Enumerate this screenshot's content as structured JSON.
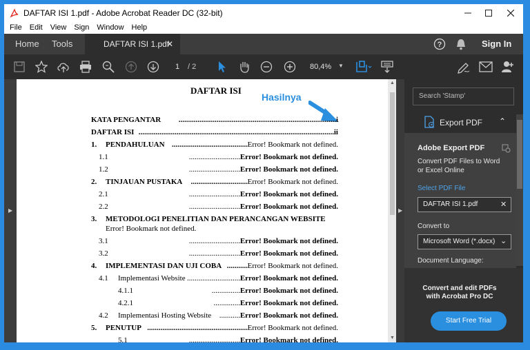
{
  "window": {
    "title": "DAFTAR ISI 1.pdf - Adobe Acrobat Reader DC (32-bit)"
  },
  "menu": [
    "File",
    "Edit",
    "View",
    "Sign",
    "Window",
    "Help"
  ],
  "tabs": {
    "home": "Home",
    "tools": "Tools",
    "document": "DAFTAR ISI 1.pdf",
    "sign_in": "Sign In"
  },
  "toolbar": {
    "page_current": "1",
    "page_total": "/ 2",
    "zoom": "80,4%"
  },
  "annotation": {
    "label": "Hasilnya",
    "color": "#2b8fe0"
  },
  "document": {
    "title": "DAFTAR ISI",
    "lines": [
      {
        "id": "l1",
        "num": "",
        "label": "KATA PENGANTAR",
        "dots": "...................................................................................",
        "tail": "i",
        "bold": true
      },
      {
        "id": "l2",
        "num": "",
        "label": "DAFTAR ISI",
        "dots": ".......................................................................................................",
        "tail": "ii",
        "bold": true
      },
      {
        "id": "l3",
        "num": "1.",
        "label": "PENDAHULUAN",
        "dots": "........................................",
        "tail": "Error! Bookmark not defined.",
        "bold": true
      },
      {
        "id": "l4",
        "num": "1.1",
        "label": "",
        "dots": "...........................",
        "tail": "Error! Bookmark not defined.",
        "bold": false
      },
      {
        "id": "l5",
        "num": "1.2",
        "label": "",
        "dots": "...........................",
        "tail": "Error! Bookmark not defined.",
        "bold": false
      },
      {
        "id": "l6",
        "num": "2.",
        "label": "TINJAUAN PUSTAKA",
        "dots": "..............................",
        "tail": "Error! Bookmark not defined.",
        "bold": true
      },
      {
        "id": "l7",
        "num": "2.1",
        "label": "",
        "dots": "...........................",
        "tail": "Error! Bookmark not defined.",
        "bold": false
      },
      {
        "id": "l8",
        "num": "2.2",
        "label": "",
        "dots": "...........................",
        "tail": "Error! Bookmark not defined.",
        "bold": false
      },
      {
        "id": "l9",
        "num": "3.",
        "label": "METODOLOGI PENELITIAN DAN PERANCANGAN WEBSITE",
        "dots": "",
        "tail": "",
        "bold": true
      },
      {
        "id": "l9b",
        "num": "",
        "label": "Error! Bookmark not defined.",
        "dots": "",
        "tail": "",
        "bold": false
      },
      {
        "id": "l10",
        "num": "3.1",
        "label": "",
        "dots": "...........................",
        "tail": "Error! Bookmark not defined.",
        "bold": false
      },
      {
        "id": "l11",
        "num": "3.2",
        "label": "",
        "dots": "...........................",
        "tail": "Error! Bookmark not defined.",
        "bold": false
      },
      {
        "id": "l12",
        "num": "4.",
        "label": "IMPLEMENTASI DAN UJI COBA",
        "dots": "...........",
        "tail": "Error! Bookmark not defined.",
        "bold": true
      },
      {
        "id": "l13",
        "num": "4.1",
        "label": "Implementasi Website",
        "dots": "............................",
        "tail": "Error! Bookmark not defined.",
        "bold": false
      },
      {
        "id": "l14",
        "num": "4.1.1",
        "label": "",
        "dots": "...............",
        "tail": "Error! Bookmark not defined.",
        "bold": false
      },
      {
        "id": "l15",
        "num": "4.2.1",
        "label": "",
        "dots": "..............",
        "tail": "Error! Bookmark not defined.",
        "bold": false
      },
      {
        "id": "l16",
        "num": "4.2",
        "label": "Implementasi Hosting Website",
        "dots": "...........",
        "tail": "Error! Bookmark not defined.",
        "bold": false
      },
      {
        "id": "l17",
        "num": "5.",
        "label": "PENUTUP",
        "dots": ".....................................................",
        "tail": "Error! Bookmark not defined.",
        "bold": true
      },
      {
        "id": "l18",
        "num": "5.1",
        "label": "",
        "dots": "...........................",
        "tail": "Error! Bookmark not defined.",
        "bold": false
      }
    ]
  },
  "right_panel": {
    "search_placeholder": "Search 'Stamp'",
    "export_header": "Export PDF",
    "section_title": "Adobe Export PDF",
    "description": "Convert PDF Files to Word or Excel Online",
    "select_label": "Select PDF File",
    "selected_file": "DAFTAR ISI 1.pdf",
    "convert_label": "Convert to",
    "convert_value": "Microsoft Word (*.docx)",
    "language_label": "Document Language:",
    "promo_text": "Convert and edit PDFs with Acrobat Pro DC",
    "trial_button": "Start Free Trial",
    "accent": "#2b8fe0"
  }
}
